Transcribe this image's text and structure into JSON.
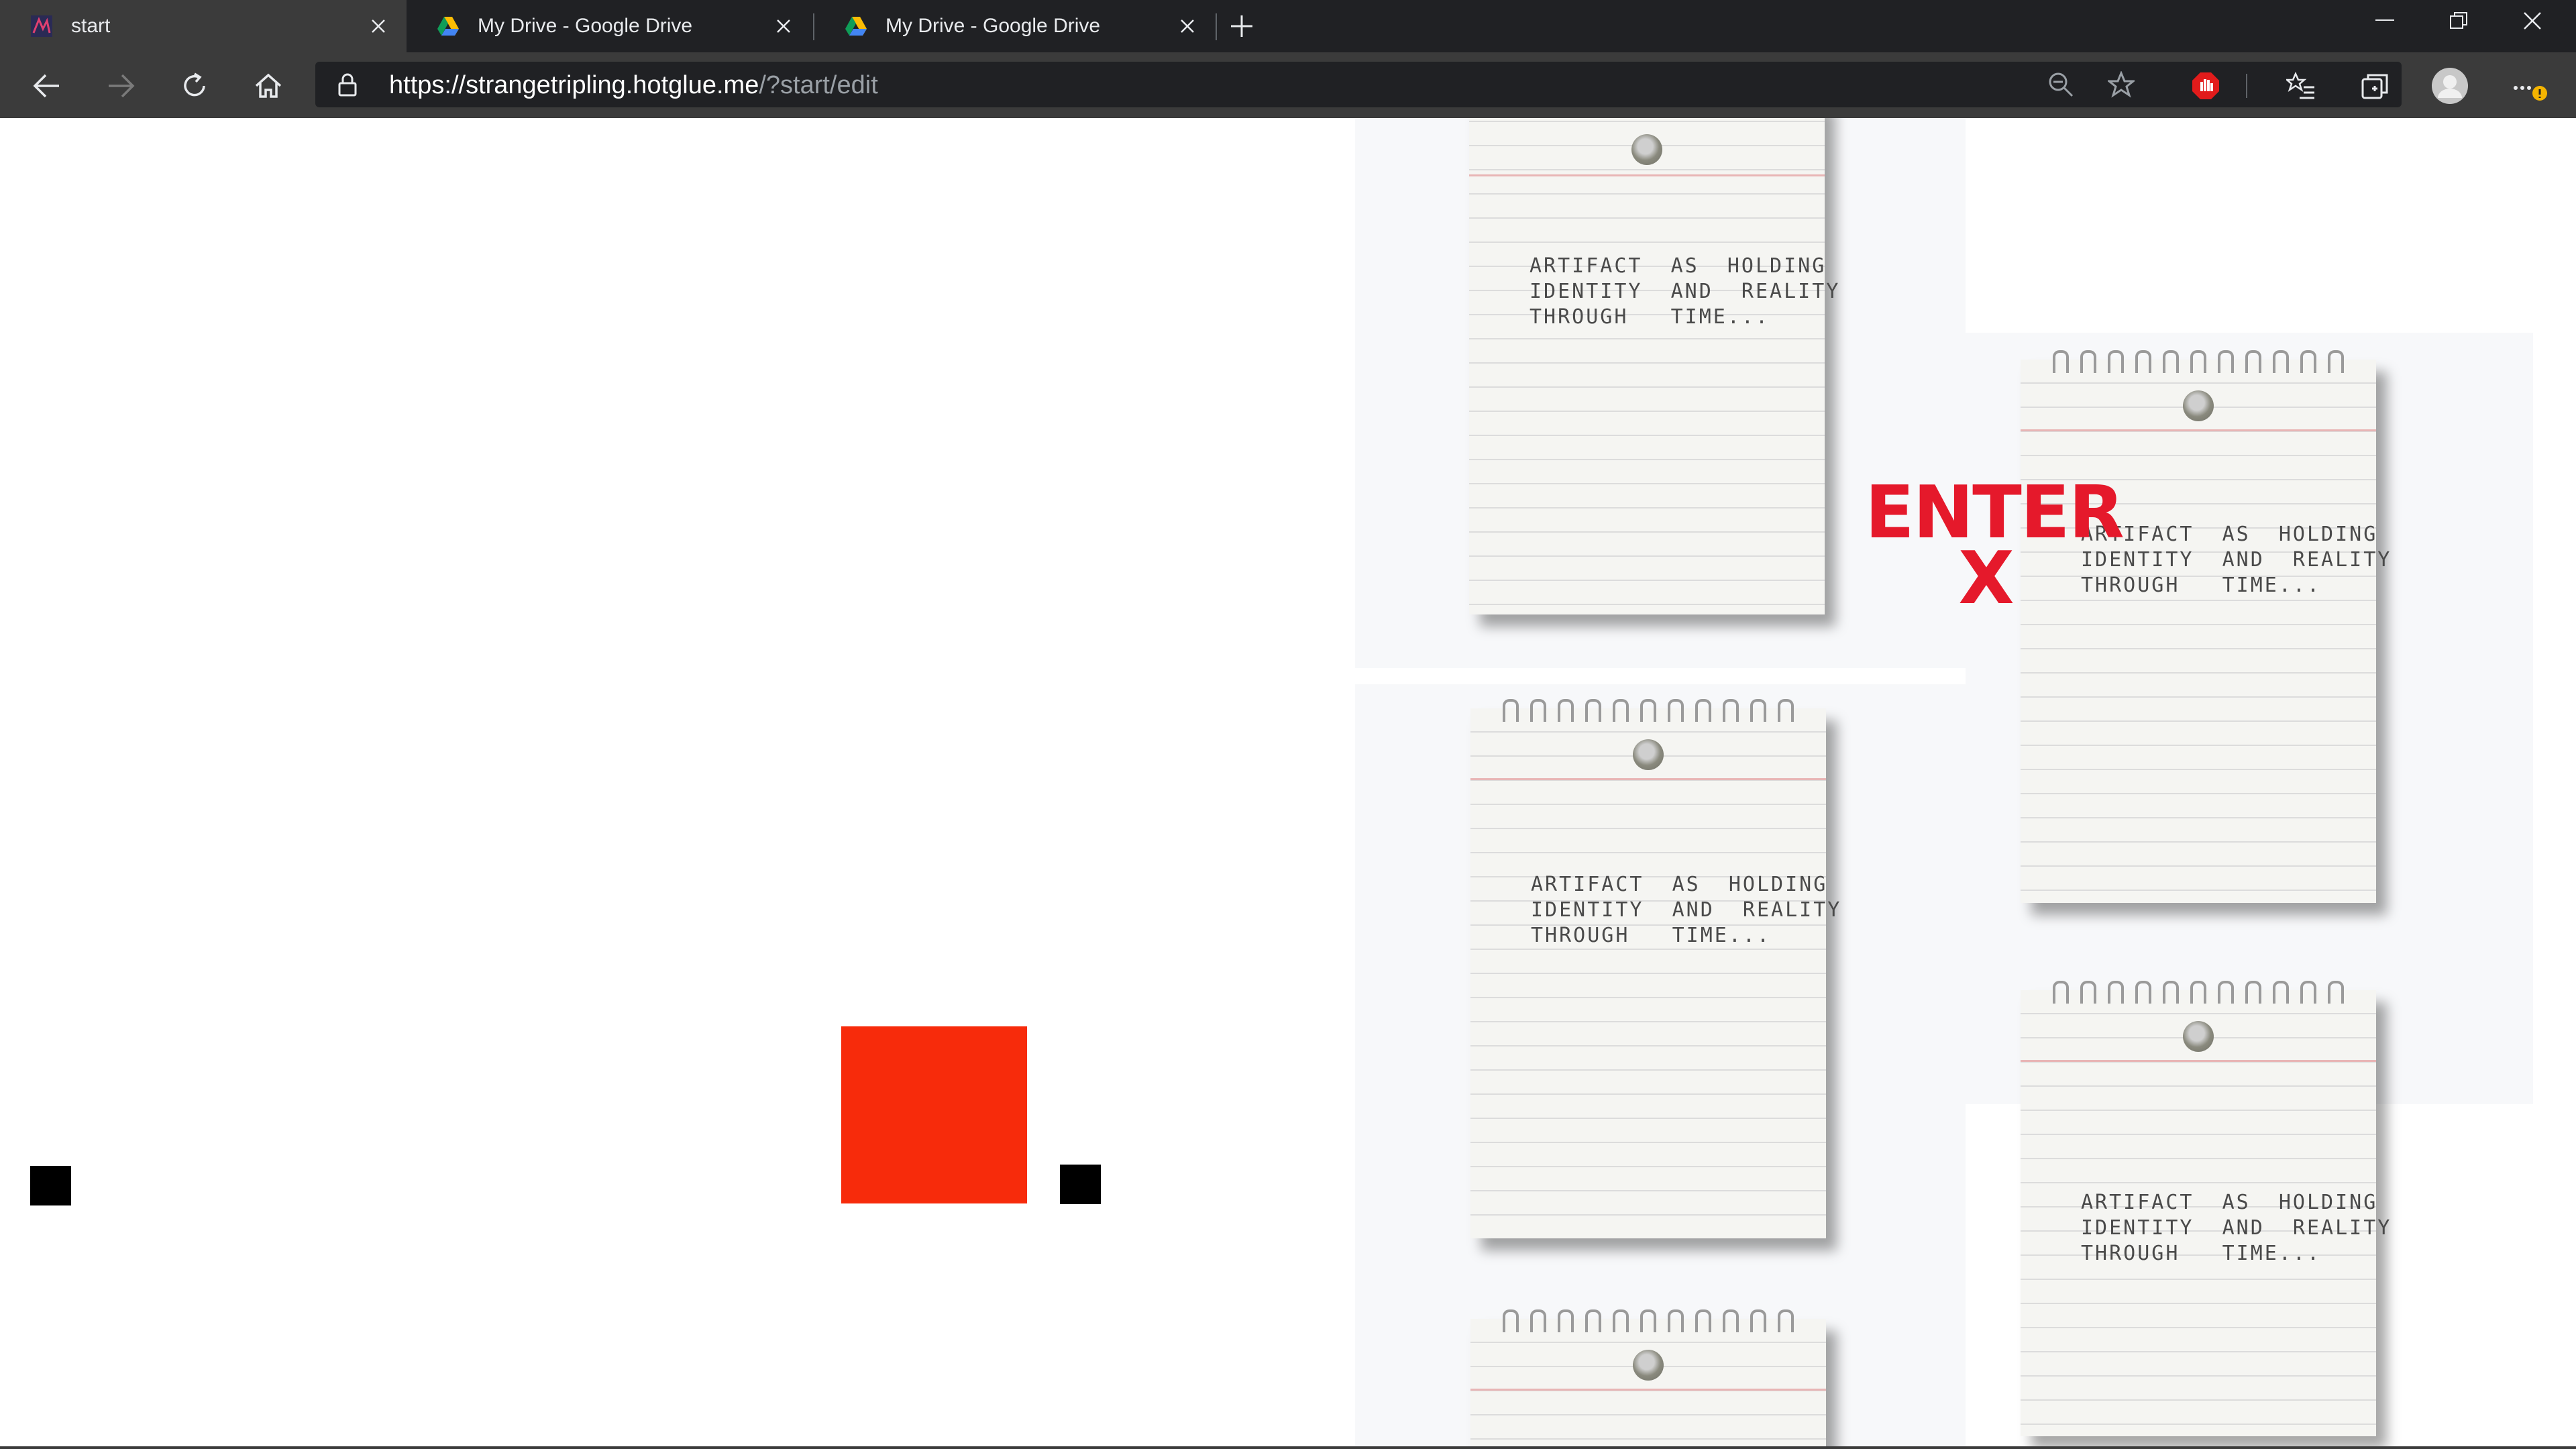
{
  "tabs": [
    {
      "title": "start",
      "active": true,
      "favicon": "hotglue-favicon"
    },
    {
      "title": "My Drive - Google Drive",
      "active": false,
      "favicon": "google-drive-icon"
    },
    {
      "title": "My Drive - Google Drive",
      "active": false,
      "favicon": "google-drive-icon"
    }
  ],
  "address": {
    "scheme": "https://",
    "host": "strangetripling.hotglue.me",
    "path": "/?start/edit"
  },
  "page": {
    "note_text_line1": "ARTIFACT  AS  HOLDING",
    "note_text_line2": "IDENTITY  AND  REALITY",
    "note_text_line3": "THROUGH   TIME...",
    "enter_label": "ENTER",
    "enter_x": "X",
    "colors": {
      "red_square": "#f72b0b",
      "enter_red": "#e5192b",
      "chrome_dark": "#202124",
      "chrome_mid": "#3b3b3b"
    }
  }
}
